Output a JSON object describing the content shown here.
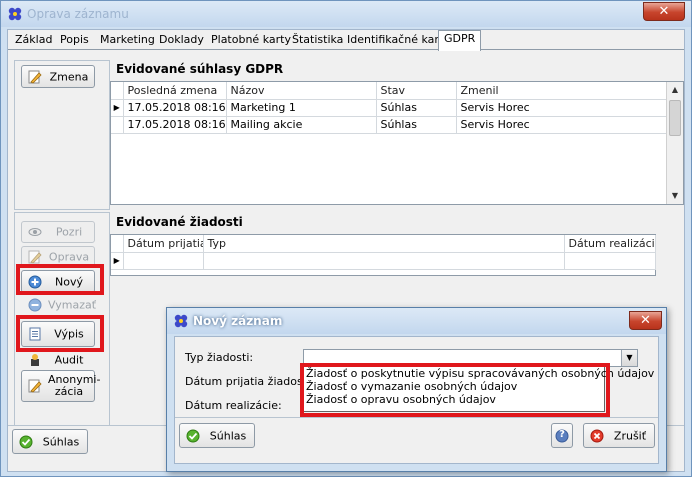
{
  "window": {
    "title": "Oprava záznamu",
    "close_glyph": "✕"
  },
  "tabs": [
    {
      "label": "Základ"
    },
    {
      "label": "Popis"
    },
    {
      "label": "Marketing"
    },
    {
      "label": "Doklady"
    },
    {
      "label": "Platobné karty"
    },
    {
      "label": "Štatistika"
    },
    {
      "label": "Identifikačné karty"
    },
    {
      "label": "GDPR",
      "active": true
    }
  ],
  "left_top": {
    "zmena_label": "Zmena"
  },
  "left_actions": {
    "pozri_label": "Pozri",
    "oprava_label": "Oprava",
    "novy_label": "Nový",
    "vymazat_label": "Vymazať",
    "vypis_label": "Výpis",
    "audit_label": "Audit",
    "anonym_line1": "Anonymi-",
    "anonym_line2": "zácia"
  },
  "consents": {
    "title": "Evidované súhlasy GDPR",
    "columns": [
      "Posledná zmena",
      "Názov",
      "Stav",
      "Zmenil"
    ],
    "rows": [
      {
        "date": "17.05.2018 08:16",
        "name": "Marketing 1",
        "status": "Súhlas",
        "by": "Servis Horec",
        "current": true
      },
      {
        "date": "17.05.2018 08:16",
        "name": "Mailing akcie",
        "status": "Súhlas",
        "by": "Servis Horec",
        "current": false
      }
    ]
  },
  "requests": {
    "title": "Evidované žiadosti",
    "columns": [
      "Dátum prijatia",
      "Typ",
      "Dátum realizácie"
    ]
  },
  "bottom": {
    "suhlas_label": "Súhlas"
  },
  "dialog": {
    "title": "Nový záznam",
    "type_label": "Typ žiadosti:",
    "received_label": "Dátum prijatia žiadosti:",
    "realized_label": "Dátum realizácie:",
    "options": [
      "Žiadosť o poskytnutie výpisu spracovávaných osobných údajov",
      "Žiadosť o vymazanie osobných údajov",
      "Žiadosť o opravu osobných údajov"
    ],
    "suhlas_label": "Súhlas",
    "zrusit_label": "Zrušiť",
    "help_glyph": "?"
  },
  "colors": {
    "highlight": "#e0171c",
    "title_bg": "#cfe0f1",
    "close_red": "#c7442c"
  }
}
